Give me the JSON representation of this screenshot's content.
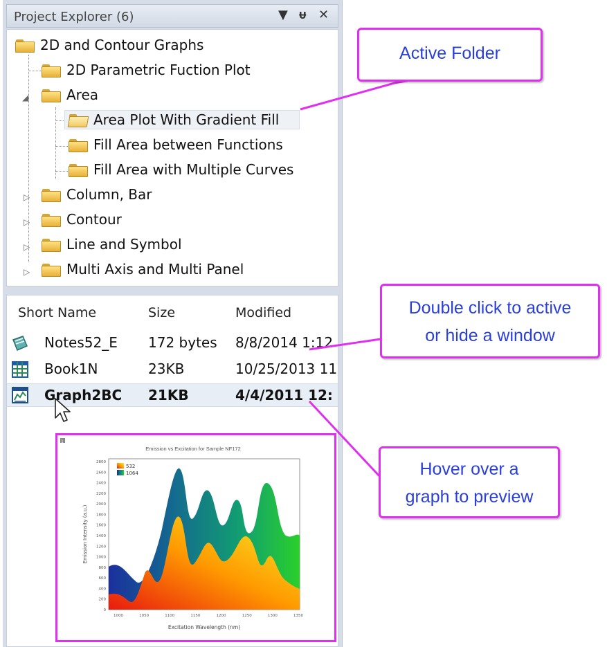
{
  "panel": {
    "title": "Project Explorer (6)",
    "buttons": {
      "dropdown": "▼",
      "pin": "ᵾ",
      "close": "✕"
    }
  },
  "tree": {
    "root": "2D and Contour Graphs",
    "items": [
      {
        "label": "2D Parametric Fuction Plot"
      },
      {
        "label": "Area"
      },
      {
        "label": "Area Plot With Gradient Fill"
      },
      {
        "label": "Fill Area between Functions"
      },
      {
        "label": "Fill Area with Multiple Curves"
      },
      {
        "label": "Column, Bar"
      },
      {
        "label": "Contour"
      },
      {
        "label": "Line and Symbol"
      },
      {
        "label": "Multi Axis and Multi Panel"
      }
    ]
  },
  "list": {
    "headers": {
      "name": "Short Name",
      "size": "Size",
      "modified": "Modified"
    },
    "rows": [
      {
        "name": "Notes52_E",
        "size": "172 bytes",
        "modified": "8/8/2014 1:12",
        "icon": "notes-icon"
      },
      {
        "name": "Book1N",
        "size": "23KB",
        "modified": "10/25/2013 11",
        "icon": "workbook-icon"
      },
      {
        "name": "Graph2BC",
        "size": "21KB",
        "modified": "4/4/2011 12:",
        "icon": "graph-icon"
      }
    ]
  },
  "preview": {
    "page_number": "1",
    "title": "Emission vs Excitation for Sample NF172",
    "ylabel": "Emission Intensity (a.u.)",
    "xlabel": "Excitation Wavelength (nm)",
    "legend": [
      "532",
      "1064"
    ],
    "yticks": [
      "2800",
      "2600",
      "2400",
      "2200",
      "2000",
      "1800",
      "1600",
      "1400",
      "1200",
      "1000",
      "800",
      "600",
      "400",
      "200",
      "0"
    ],
    "xticks": [
      "1000",
      "1050",
      "1100",
      "1150",
      "1200",
      "1250",
      "1300",
      "1350"
    ]
  },
  "callouts": {
    "active_folder": "Active Folder",
    "double_click_line1": "Double click to active",
    "double_click_line2": "or hide a window",
    "hover_line1": "Hover over a",
    "hover_line2": "graph to preview"
  },
  "colors": {
    "callout_border": "#e02ff0",
    "callout_text": "#2a3fd9"
  }
}
